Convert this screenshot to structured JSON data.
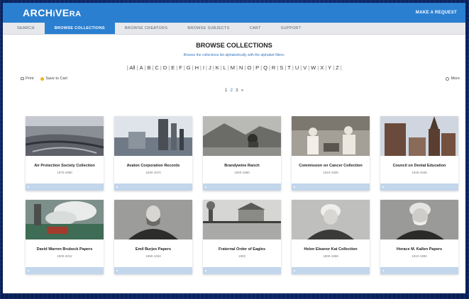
{
  "brand": {
    "logo_main": "ARCH",
    "logo_mid": "i",
    "logo_tail": "VE",
    "logo_end": "RA"
  },
  "header": {
    "request_label": "MAKE A REQUEST"
  },
  "nav": [
    {
      "label": "SEARCH",
      "active": false
    },
    {
      "label": "BROWSE COLLECTIONS",
      "active": true
    },
    {
      "label": "BROWSE CREATORS",
      "active": false
    },
    {
      "label": "BROWSE SUBJECTS",
      "active": false
    },
    {
      "label": "CART",
      "active": false
    },
    {
      "label": "SUPPORT",
      "active": false
    }
  ],
  "page": {
    "title": "BROWSE COLLECTIONS",
    "subtitle": "Browse the collections list alphabetically with the alphabet filters."
  },
  "alphabet": [
    "All",
    "A",
    "B",
    "C",
    "D",
    "E",
    "F",
    "G",
    "H",
    "I",
    "J",
    "K",
    "L",
    "M",
    "N",
    "O",
    "P",
    "Q",
    "R",
    "S",
    "T",
    "U",
    "V",
    "W",
    "X",
    "Y",
    "Z"
  ],
  "actions": {
    "print": "Print",
    "save": "Save to Cart",
    "more": "More"
  },
  "pager": {
    "pages": [
      "1",
      "2",
      "3",
      "»"
    ],
    "current": "2"
  },
  "collections": [
    {
      "title": "Air Protection Society Collection",
      "dates": "1970-1990",
      "img": "aerial",
      "icon": "collection-thumbnail"
    },
    {
      "title": "Avalon Corporation Records",
      "dates": "1920-1970",
      "img": "industrial"
    },
    {
      "title": "Brandywine Ranch",
      "dates": "1900-1980",
      "img": "ranch"
    },
    {
      "title": "Commission on Cancer Collection",
      "dates": "1910-1930",
      "img": "medical"
    },
    {
      "title": "Council on Dental Education",
      "dates": "1940-1945",
      "img": "church"
    },
    {
      "title": "David Warren Brubeck Papers",
      "dates": "1900-2012",
      "img": "steam"
    },
    {
      "title": "Emil Burjes Papers",
      "dates": "1890-1934",
      "img": "portrait1"
    },
    {
      "title": "Fraternal Order of Eagles",
      "dates": "1903",
      "img": "lake"
    },
    {
      "title": "Helen Eleanor Kat Collection",
      "dates": "1900-1958",
      "img": "portrait2"
    },
    {
      "title": "Horace M. Kallen Papers",
      "dates": "1910-1990",
      "img": "portrait3"
    }
  ]
}
